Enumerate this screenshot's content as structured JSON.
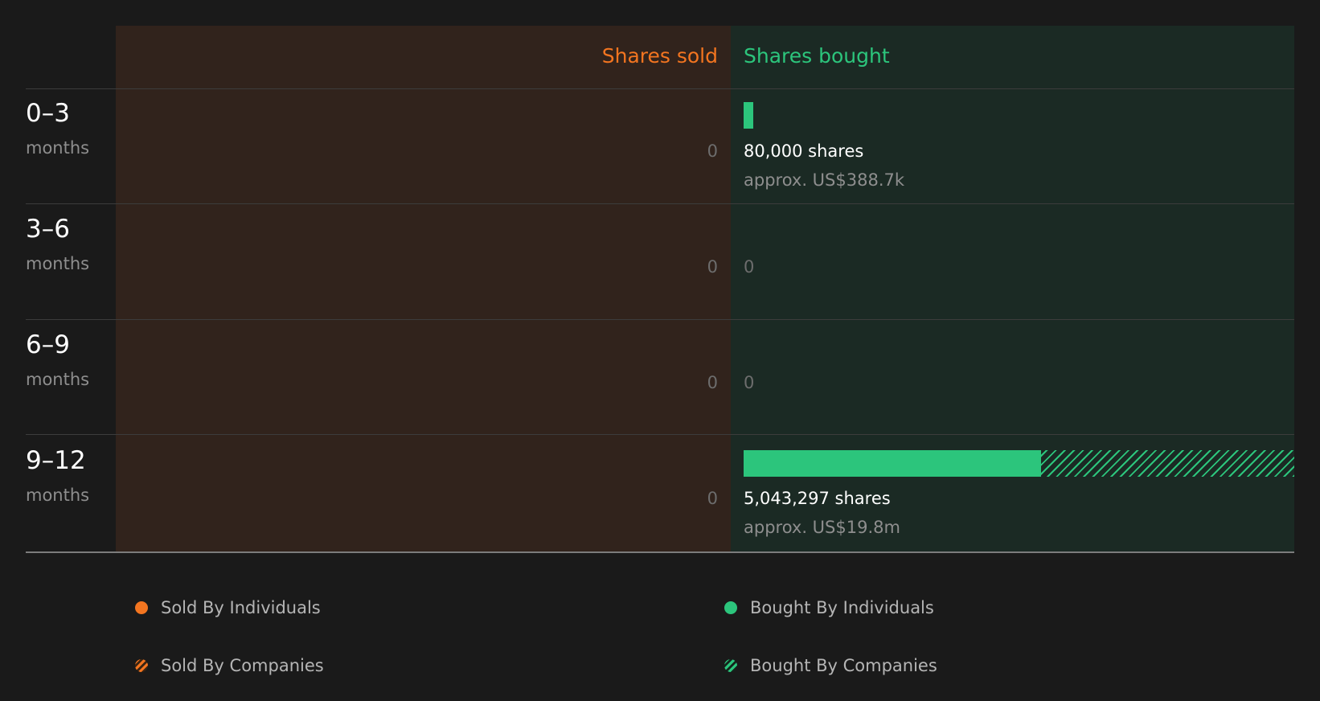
{
  "colors": {
    "sold": "#f37520",
    "bought": "#2cc57c",
    "background": "#1a1a1a"
  },
  "chart_data": {
    "type": "bar",
    "headers": {
      "sold": "Shares sold",
      "bought": "Shares bought"
    },
    "periods": [
      {
        "range": "0–3",
        "unit": "months",
        "sold_label": "0",
        "bought_individuals": 80000,
        "bought_companies": 0,
        "bought_label": "80,000 shares",
        "bought_value": "approx. US$388.7k"
      },
      {
        "range": "3–6",
        "unit": "months",
        "sold_label": "0",
        "bought_individuals": 0,
        "bought_companies": 0,
        "bought_label": "0",
        "bought_value": ""
      },
      {
        "range": "6–9",
        "unit": "months",
        "sold_label": "0",
        "bought_individuals": 0,
        "bought_companies": 0,
        "bought_label": "0",
        "bought_value": ""
      },
      {
        "range": "9–12",
        "unit": "months",
        "sold_label": "0",
        "bought_individuals": 2725000,
        "bought_companies": 2318297,
        "bought_label": "5,043,297 shares",
        "bought_value": "approx. US$19.8m"
      }
    ],
    "legend": {
      "sold_individuals": "Sold By Individuals",
      "sold_companies": "Sold By Companies",
      "bought_individuals": "Bought By Individuals",
      "bought_companies": "Bought By Companies"
    }
  }
}
